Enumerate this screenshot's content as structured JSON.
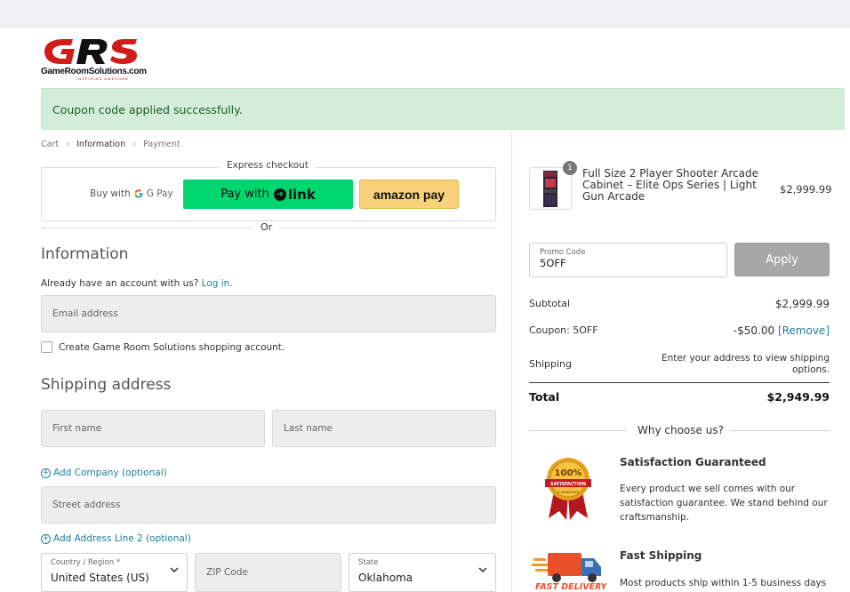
{
  "brand": {
    "name": "GameRoomSolutions.com",
    "tagline": "INSPIRING AWESOME",
    "accent": "#c0121b"
  },
  "alert": {
    "message": "Coupon code applied successfully."
  },
  "breadcrumb": {
    "items": [
      "Cart",
      "Information",
      "Payment"
    ],
    "active_index": 1
  },
  "express": {
    "legend": "Express checkout",
    "gpay_prefix": "Buy with",
    "gpay_label": "G Pay",
    "link_prefix": "Pay with",
    "link_label": "link",
    "amazon_label": "amazon pay",
    "or_text": "Or"
  },
  "information": {
    "heading": "Information",
    "account_prompt": "Already have an account with us?",
    "login_link": "Log in.",
    "email_placeholder": "Email address",
    "create_account_label": "Create Game Room Solutions shopping account."
  },
  "shipping": {
    "heading": "Shipping address",
    "first_name_placeholder": "First name",
    "last_name_placeholder": "Last name",
    "add_company": "Add Company (optional)",
    "street_placeholder": "Street address",
    "add_line2": "Add Address Line 2 (optional)",
    "country_label": "Country / Region *",
    "country_value": "United States (US)",
    "zip_placeholder": "ZIP Code",
    "state_label": "State",
    "state_value": "Oklahoma"
  },
  "order": {
    "item": {
      "quantity": "1",
      "name": "Full Size 2 Player Shooter Arcade Cabinet – Elite Ops Series | Light Gun Arcade",
      "price": "$2,999.99"
    },
    "promo_label": "Promo Code",
    "promo_value": "5OFF",
    "apply_label": "Apply",
    "subtotal_label": "Subtotal",
    "subtotal_value": "$2,999.99",
    "coupon_label": "Coupon: 5OFF",
    "coupon_value": "-$50.00",
    "remove_label": "[Remove]",
    "shipping_label": "Shipping",
    "shipping_note": "Enter your address to view shipping options.",
    "total_label": "Total",
    "total_value": "$2,949.99"
  },
  "why": {
    "heading": "Why choose us?",
    "features": [
      {
        "title": "Satisfaction Guaranteed",
        "desc": "Every product we sell comes with our satisfaction guarantee. We stand behind our craftsmanship.",
        "badge_top": "100%",
        "badge_text": "SATISFACTION",
        "badge_bottom": "GUARANTEED"
      },
      {
        "title": "Fast Shipping",
        "desc": "Most products ship within 1-5 business days",
        "badge_text": "FAST DELIVERY"
      }
    ]
  },
  "colors": {
    "link": "#1a7f9f",
    "alert_bg": "#d4edda",
    "link_pay_bg": "#00d66f",
    "amazon_bg": "#f7d27a"
  }
}
